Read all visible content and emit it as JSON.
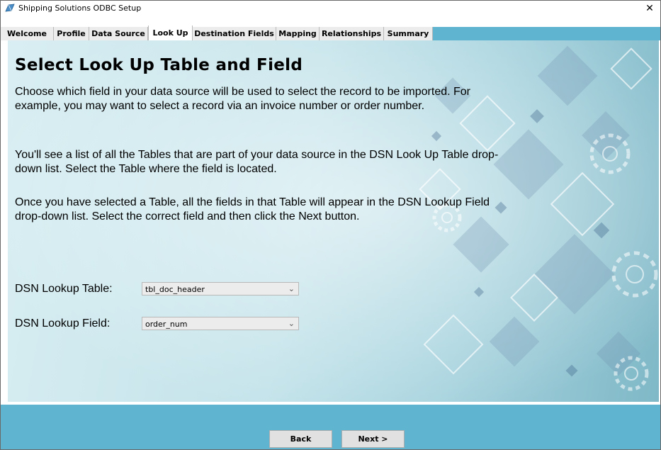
{
  "window": {
    "title": "Shipping Solutions ODBC Setup",
    "close_label": "✕"
  },
  "tabs": [
    {
      "label": "Welcome"
    },
    {
      "label": "Profile"
    },
    {
      "label": "Data Source"
    },
    {
      "label": "Look Up"
    },
    {
      "label": "Destination Fields"
    },
    {
      "label": "Mapping"
    },
    {
      "label": "Relationships"
    },
    {
      "label": "Summary"
    }
  ],
  "active_tab": "Look Up",
  "content": {
    "heading": "Select Look Up Table and Field",
    "paragraphs": [
      "Choose which field in your data source will be used to select the record to be imported. For example, you may want to select a record via an invoice number or order number.",
      "You'll see a list of all the Tables that are part of your data source in the DSN Look Up Table drop-down list. Select the Table where the field is located.",
      "Once you have selected a Table, all the fields in that Table will appear in the DSN Lookup Field drop-down list. Select the correct field and then click the Next button."
    ]
  },
  "form": {
    "table_label": "DSN Lookup Table:",
    "table_value": "tbl_doc_header",
    "field_label": "DSN Lookup Field:",
    "field_value": "order_num"
  },
  "buttons": {
    "back": "Back",
    "next": "Next >"
  },
  "colors": {
    "accent": "#5fb5cf",
    "tab_bg": "#ececec",
    "panel_light": "#d9eef2",
    "panel_dark": "#7fb8c7"
  },
  "icons": {
    "app": "app-icon",
    "close": "close-icon",
    "dropdown": "chevron-down-icon"
  }
}
